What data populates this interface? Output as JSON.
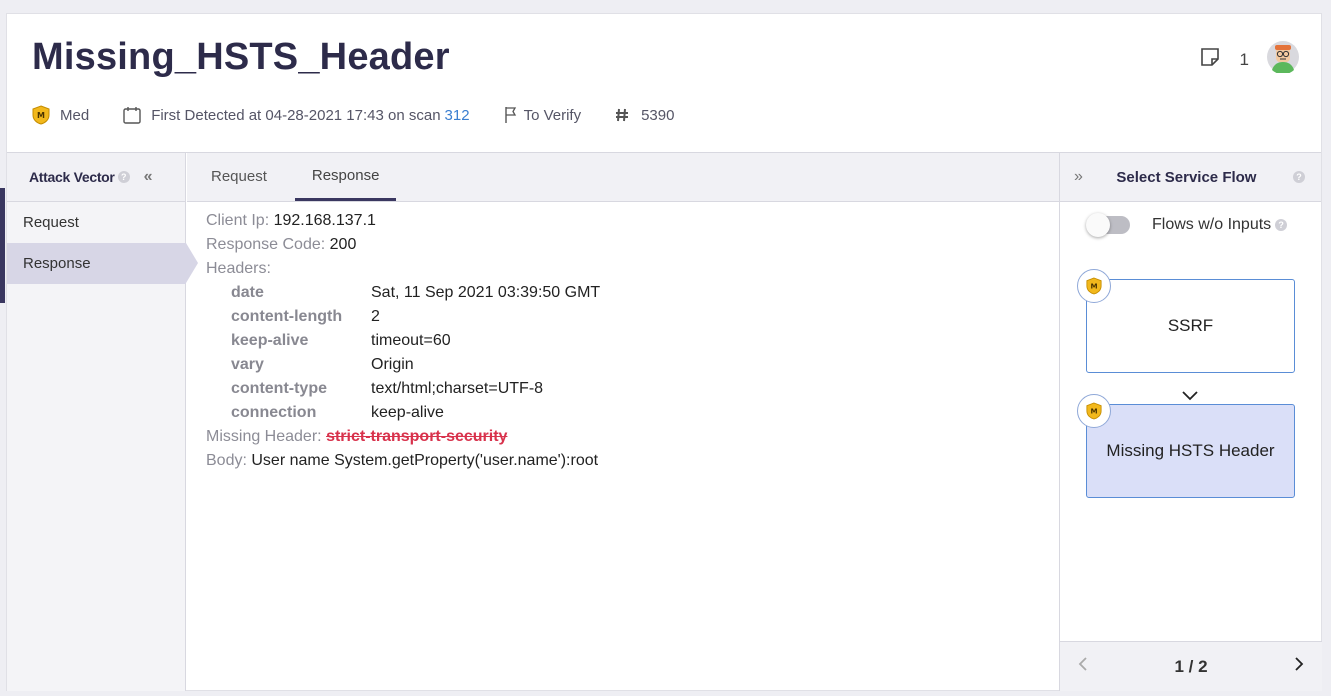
{
  "issue": {
    "title": "Missing_HSTS_Header",
    "severity": "Med",
    "first_detected": "First Detected at 04-28-2021 17:43 on scan",
    "scan_number": "312",
    "status": "To Verify",
    "id": "5390",
    "comment_count": "1"
  },
  "attack_vector": {
    "title": "Attack Vector",
    "items": [
      {
        "label": "Request"
      },
      {
        "label": "Response"
      }
    ]
  },
  "tabs": [
    {
      "label": "Request"
    },
    {
      "label": "Response"
    }
  ],
  "response": {
    "client_ip_label": "Client Ip:",
    "client_ip": "192.168.137.1",
    "code_label": "Response Code:",
    "code": "200",
    "headers_label": "Headers:",
    "headers": [
      {
        "key": "date",
        "value": "Sat, 11 Sep 2021 03:39:50 GMT"
      },
      {
        "key": "content-length",
        "value": "2"
      },
      {
        "key": "keep-alive",
        "value": "timeout=60"
      },
      {
        "key": "vary",
        "value": "Origin"
      },
      {
        "key": "content-type",
        "value": "text/html;charset=UTF-8"
      },
      {
        "key": "connection",
        "value": "keep-alive"
      }
    ],
    "missing_label": "Missing Header:",
    "missing_header": "strict-transport-security",
    "body_label": "Body:",
    "body": "User name System.getProperty('user.name'):root"
  },
  "service_flow": {
    "title": "Select Service Flow",
    "toggle_label": "Flows w/o Inputs",
    "flows": [
      {
        "label": "SSRF",
        "badge": "M"
      },
      {
        "label": "Missing HSTS Header",
        "badge": "M"
      }
    ],
    "pager": "1 / 2"
  },
  "colors": {
    "accent": "#3a3760",
    "link": "#3a7ed0",
    "missing_header": "#d8324c",
    "severity_shield": "#f2b81c",
    "selected_flow": "#dadff8"
  }
}
